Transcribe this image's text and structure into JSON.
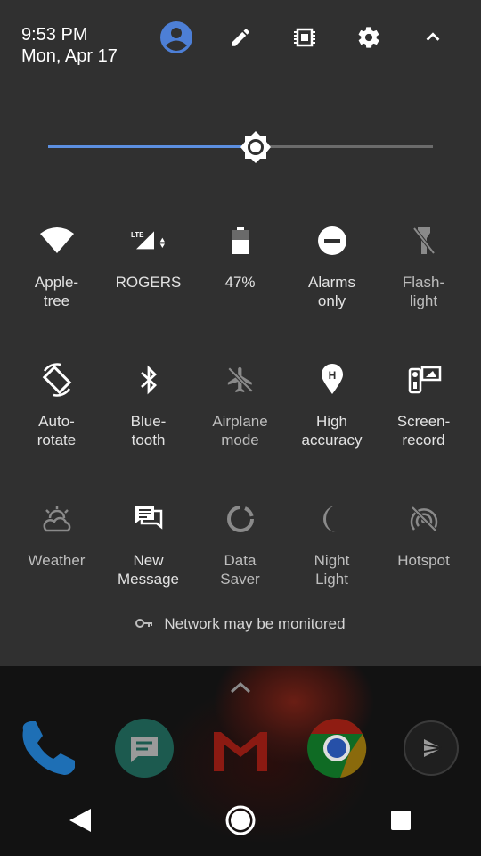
{
  "status": {
    "time": "9:53 PM",
    "date": "Mon, Apr 17"
  },
  "header_icons": [
    "account-icon",
    "edit-icon",
    "memory-icon",
    "settings-icon",
    "collapse-icon"
  ],
  "brightness": {
    "level": 0.54,
    "accent": "#5c8fe0"
  },
  "tiles": [
    {
      "label": "Apple-\ntree",
      "icon": "wifi-icon"
    },
    {
      "label": "ROGERS",
      "icon": "lte-signal-icon"
    },
    {
      "label": "47%",
      "icon": "battery-icon"
    },
    {
      "label": "Alarms\nonly",
      "icon": "do-not-disturb-icon"
    },
    {
      "label": "Flash-\nlight",
      "icon": "flashlight-icon"
    },
    {
      "label": "Auto-\nrotate",
      "icon": "auto-rotate-icon"
    },
    {
      "label": "Blue-\ntooth",
      "icon": "bluetooth-icon"
    },
    {
      "label": "Airplane\nmode",
      "icon": "airplane-icon"
    },
    {
      "label": "High\naccuracy",
      "icon": "location-icon"
    },
    {
      "label": "Screen-\nrecord",
      "icon": "screen-record-icon"
    },
    {
      "label": "Weather",
      "icon": "weather-icon"
    },
    {
      "label": "New\nMessage",
      "icon": "message-icon"
    },
    {
      "label": "Data\nSaver",
      "icon": "data-saver-icon"
    },
    {
      "label": "Night\nLight",
      "icon": "night-light-icon"
    },
    {
      "label": "Hotspot",
      "icon": "hotspot-icon"
    }
  ],
  "network_notice": "Network may be monitored",
  "dock": [
    "phone-app-icon",
    "messages-app-icon",
    "gmail-app-icon",
    "chrome-app-icon",
    "play-movies-app-icon"
  ],
  "nav": [
    "back-icon",
    "home-icon",
    "recents-icon"
  ],
  "colors": {
    "panel": "#303030",
    "icon_active": "#ffffff",
    "icon_dim": "#8a8a8a"
  }
}
